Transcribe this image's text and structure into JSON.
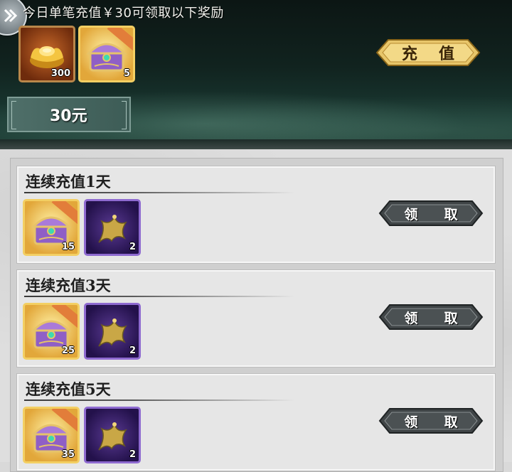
{
  "promo": {
    "title": "今日单笔充值￥30可领取以下奖励",
    "items": [
      {
        "name": "gold-ingot",
        "qty": "300"
      },
      {
        "name": "treasure-chest",
        "qty": "5"
      }
    ],
    "charge_label": "充 值",
    "price_label": "30元"
  },
  "cards": [
    {
      "title": "连续充值1天",
      "items": [
        {
          "name": "treasure-chest",
          "qty": "15"
        },
        {
          "name": "dragon-scroll",
          "qty": "2"
        }
      ],
      "claim_label": "领 取"
    },
    {
      "title": "连续充值3天",
      "items": [
        {
          "name": "treasure-chest",
          "qty": "25"
        },
        {
          "name": "dragon-scroll",
          "qty": "2"
        }
      ],
      "claim_label": "领 取"
    },
    {
      "title": "连续充值5天",
      "items": [
        {
          "name": "treasure-chest",
          "qty": "35"
        },
        {
          "name": "dragon-scroll",
          "qty": "2"
        }
      ],
      "claim_label": "领 取"
    }
  ],
  "colors": {
    "gold_button": "#e8c66a",
    "dark_button": "#3f4446",
    "banner_bg": "#11231f",
    "list_bg": "#dedede"
  }
}
